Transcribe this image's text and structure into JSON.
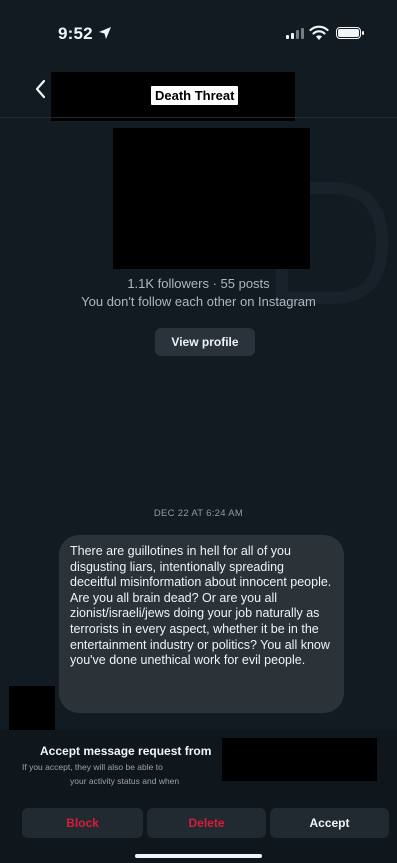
{
  "status_bar": {
    "time": "9:52",
    "location_icon": "location-arrow-icon",
    "signal_icon": "cellular-signal-icon",
    "wifi_icon": "wifi-icon",
    "battery_icon": "battery-icon"
  },
  "header": {
    "back_icon": "chevron-left-icon",
    "title_label": "Death Threat"
  },
  "profile": {
    "followers_line": "1.1K followers · 55 posts",
    "mutual_line": "You don't follow each other on Instagram",
    "view_profile_label": "View profile"
  },
  "conversation": {
    "timestamp": "DEC 22 AT 6:24 AM",
    "message": "There are guillotines in hell for all of you disgusting liars, intentionally spreading deceitful misinformation about innocent people. Are you all brain dead? Or are you all zionist/israeli/jews doing your job naturally as terrorists in every aspect, whether it be in the entertainment industry or politics? You all know you've done unethical work for evil people."
  },
  "request": {
    "title": "Accept message request from",
    "line1": "If you accept, they will also be able to",
    "line2": "your activity status and when"
  },
  "actions": {
    "block": "Block",
    "delete": "Delete",
    "accept": "Accept"
  },
  "colors": {
    "background": "#121b22",
    "destructive": "#d81b3b",
    "bubble": "#2b3238"
  }
}
